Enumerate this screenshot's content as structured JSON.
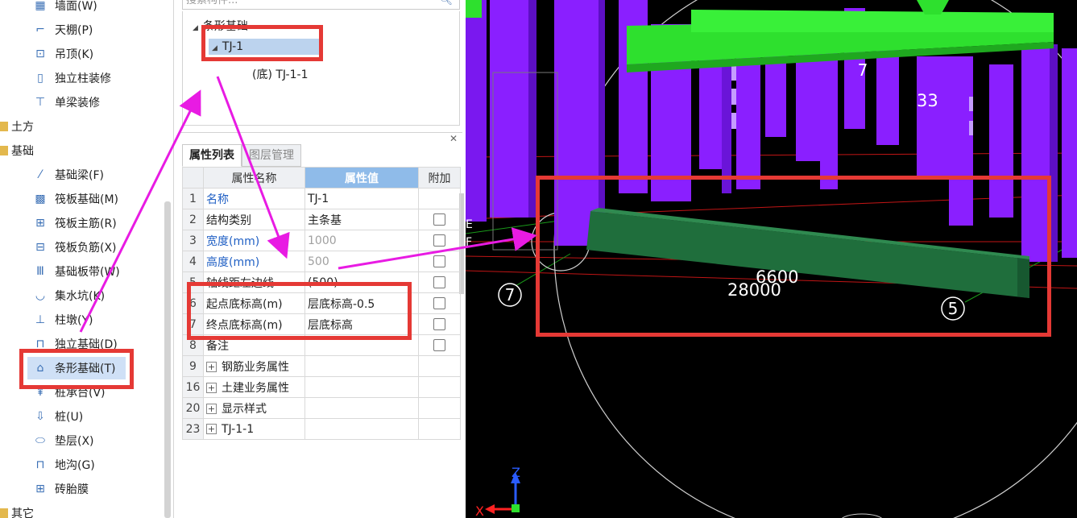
{
  "left_tree": {
    "items": [
      {
        "label": "墙面(W)",
        "icon": "wall-finish-icon",
        "kind": "sub",
        "y": 0
      },
      {
        "label": "天棚(P)",
        "icon": "ceiling-icon",
        "kind": "sub",
        "y": 1
      },
      {
        "label": "吊顶(K)",
        "icon": "suspended-ceiling-icon",
        "kind": "sub",
        "y": 2
      },
      {
        "label": "独立柱装修",
        "icon": "column-finish-icon",
        "kind": "sub",
        "y": 3
      },
      {
        "label": "单梁装修",
        "icon": "beam-finish-icon",
        "kind": "sub",
        "y": 4
      },
      {
        "label": "土方",
        "icon": "folder-icon",
        "kind": "cat",
        "y": 5
      },
      {
        "label": "基础",
        "icon": "folder-icon",
        "kind": "cat",
        "y": 6
      },
      {
        "label": "基础梁(F)",
        "icon": "foundation-beam-icon",
        "kind": "sub",
        "y": 7
      },
      {
        "label": "筏板基础(M)",
        "icon": "raft-foundation-icon",
        "kind": "sub",
        "y": 8
      },
      {
        "label": "筏板主筋(R)",
        "icon": "raft-main-rebar-icon",
        "kind": "sub",
        "y": 9
      },
      {
        "label": "筏板负筋(X)",
        "icon": "raft-negative-rebar-icon",
        "kind": "sub",
        "y": 10
      },
      {
        "label": "基础板带(W)",
        "icon": "foundation-strip-icon",
        "kind": "sub",
        "y": 11
      },
      {
        "label": "集水坑(K)",
        "icon": "sump-pit-icon",
        "kind": "sub",
        "y": 12
      },
      {
        "label": "柱墩(Y)",
        "icon": "column-pier-icon",
        "kind": "sub",
        "y": 13
      },
      {
        "label": "独立基础(D)",
        "icon": "isolated-footing-icon",
        "kind": "sub",
        "y": 14
      },
      {
        "label": "条形基础(T)",
        "icon": "strip-footing-icon",
        "kind": "sub",
        "y": 15,
        "selected": true
      },
      {
        "label": "桩承台(V)",
        "icon": "pile-cap-icon",
        "kind": "sub",
        "y": 16
      },
      {
        "label": "桩(U)",
        "icon": "pile-icon",
        "kind": "sub",
        "y": 17
      },
      {
        "label": "垫层(X)",
        "icon": "cushion-icon",
        "kind": "sub",
        "y": 18
      },
      {
        "label": "地沟(G)",
        "icon": "trench-icon",
        "kind": "sub",
        "y": 19
      },
      {
        "label": "砖胎膜",
        "icon": "brick-form-icon",
        "kind": "sub",
        "y": 20
      },
      {
        "label": "其它",
        "icon": "folder-icon",
        "kind": "cat",
        "y": 21
      }
    ]
  },
  "search": {
    "placeholder": "搜索构件..."
  },
  "component_tree": {
    "root": "条形基础",
    "child": "TJ-1",
    "leaf": "(底) TJ-1-1"
  },
  "properties": {
    "tabs": [
      "属性列表",
      "图层管理"
    ],
    "headers": [
      "属性名称",
      "属性值",
      "附加"
    ],
    "rows": [
      {
        "num": "1",
        "name": "名称",
        "value": "TJ-1",
        "blue": true,
        "check": false
      },
      {
        "num": "2",
        "name": "结构类别",
        "value": "主条基",
        "blue": false,
        "check": true
      },
      {
        "num": "3",
        "name": "宽度(mm)",
        "value": "1000",
        "blue": true,
        "gray": true,
        "check": true
      },
      {
        "num": "4",
        "name": "高度(mm)",
        "value": "500",
        "blue": true,
        "gray": true,
        "check": true
      },
      {
        "num": "5",
        "name": "轴线距左边线",
        "value": "(500)",
        "blue": false,
        "check": true
      },
      {
        "num": "6",
        "name": "起点底标高(m)",
        "value": "层底标高-0.5",
        "blue": false,
        "check": true
      },
      {
        "num": "7",
        "name": "终点底标高(m)",
        "value": "层底标高",
        "blue": false,
        "check": true,
        "selected": true
      },
      {
        "num": "8",
        "name": "备注",
        "value": "",
        "blue": false,
        "check": true
      },
      {
        "num": "9",
        "name": "钢筋业务属性",
        "value": "",
        "plus": true
      },
      {
        "num": "16",
        "name": "土建业务属性",
        "value": "",
        "plus": true
      },
      {
        "num": "20",
        "name": "显示样式",
        "value": "",
        "plus": true
      },
      {
        "num": "23",
        "name": "TJ-1-1",
        "value": "",
        "plus": true
      }
    ]
  },
  "viewport": {
    "labels": {
      "dim1": "6600",
      "dim2": "28000",
      "axis7": "7",
      "axis5": "5",
      "partial33": "33",
      "axis_top": "7",
      "axisE": "E",
      "axisF": "F",
      "axis_x": "X",
      "axis_z": "Z"
    },
    "colors": {
      "column": "#8a1fff",
      "beam_green": "#2ee02e",
      "footing": "#1f6e3c",
      "background": "#000000"
    }
  },
  "annotation": {
    "color": "#e53935",
    "arrow_color": "#e81be3"
  }
}
